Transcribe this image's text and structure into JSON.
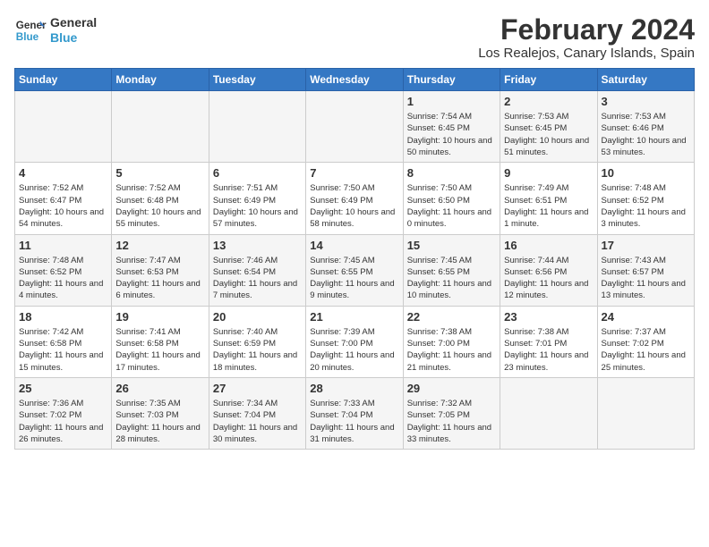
{
  "header": {
    "logo_general": "General",
    "logo_blue": "Blue",
    "month_year": "February 2024",
    "location": "Los Realejos, Canary Islands, Spain"
  },
  "days_of_week": [
    "Sunday",
    "Monday",
    "Tuesday",
    "Wednesday",
    "Thursday",
    "Friday",
    "Saturday"
  ],
  "weeks": [
    [
      {
        "day": "",
        "info": ""
      },
      {
        "day": "",
        "info": ""
      },
      {
        "day": "",
        "info": ""
      },
      {
        "day": "",
        "info": ""
      },
      {
        "day": "1",
        "info": "Sunrise: 7:54 AM\nSunset: 6:45 PM\nDaylight: 10 hours and 50 minutes."
      },
      {
        "day": "2",
        "info": "Sunrise: 7:53 AM\nSunset: 6:45 PM\nDaylight: 10 hours and 51 minutes."
      },
      {
        "day": "3",
        "info": "Sunrise: 7:53 AM\nSunset: 6:46 PM\nDaylight: 10 hours and 53 minutes."
      }
    ],
    [
      {
        "day": "4",
        "info": "Sunrise: 7:52 AM\nSunset: 6:47 PM\nDaylight: 10 hours and 54 minutes."
      },
      {
        "day": "5",
        "info": "Sunrise: 7:52 AM\nSunset: 6:48 PM\nDaylight: 10 hours and 55 minutes."
      },
      {
        "day": "6",
        "info": "Sunrise: 7:51 AM\nSunset: 6:49 PM\nDaylight: 10 hours and 57 minutes."
      },
      {
        "day": "7",
        "info": "Sunrise: 7:50 AM\nSunset: 6:49 PM\nDaylight: 10 hours and 58 minutes."
      },
      {
        "day": "8",
        "info": "Sunrise: 7:50 AM\nSunset: 6:50 PM\nDaylight: 11 hours and 0 minutes."
      },
      {
        "day": "9",
        "info": "Sunrise: 7:49 AM\nSunset: 6:51 PM\nDaylight: 11 hours and 1 minute."
      },
      {
        "day": "10",
        "info": "Sunrise: 7:48 AM\nSunset: 6:52 PM\nDaylight: 11 hours and 3 minutes."
      }
    ],
    [
      {
        "day": "11",
        "info": "Sunrise: 7:48 AM\nSunset: 6:52 PM\nDaylight: 11 hours and 4 minutes."
      },
      {
        "day": "12",
        "info": "Sunrise: 7:47 AM\nSunset: 6:53 PM\nDaylight: 11 hours and 6 minutes."
      },
      {
        "day": "13",
        "info": "Sunrise: 7:46 AM\nSunset: 6:54 PM\nDaylight: 11 hours and 7 minutes."
      },
      {
        "day": "14",
        "info": "Sunrise: 7:45 AM\nSunset: 6:55 PM\nDaylight: 11 hours and 9 minutes."
      },
      {
        "day": "15",
        "info": "Sunrise: 7:45 AM\nSunset: 6:55 PM\nDaylight: 11 hours and 10 minutes."
      },
      {
        "day": "16",
        "info": "Sunrise: 7:44 AM\nSunset: 6:56 PM\nDaylight: 11 hours and 12 minutes."
      },
      {
        "day": "17",
        "info": "Sunrise: 7:43 AM\nSunset: 6:57 PM\nDaylight: 11 hours and 13 minutes."
      }
    ],
    [
      {
        "day": "18",
        "info": "Sunrise: 7:42 AM\nSunset: 6:58 PM\nDaylight: 11 hours and 15 minutes."
      },
      {
        "day": "19",
        "info": "Sunrise: 7:41 AM\nSunset: 6:58 PM\nDaylight: 11 hours and 17 minutes."
      },
      {
        "day": "20",
        "info": "Sunrise: 7:40 AM\nSunset: 6:59 PM\nDaylight: 11 hours and 18 minutes."
      },
      {
        "day": "21",
        "info": "Sunrise: 7:39 AM\nSunset: 7:00 PM\nDaylight: 11 hours and 20 minutes."
      },
      {
        "day": "22",
        "info": "Sunrise: 7:38 AM\nSunset: 7:00 PM\nDaylight: 11 hours and 21 minutes."
      },
      {
        "day": "23",
        "info": "Sunrise: 7:38 AM\nSunset: 7:01 PM\nDaylight: 11 hours and 23 minutes."
      },
      {
        "day": "24",
        "info": "Sunrise: 7:37 AM\nSunset: 7:02 PM\nDaylight: 11 hours and 25 minutes."
      }
    ],
    [
      {
        "day": "25",
        "info": "Sunrise: 7:36 AM\nSunset: 7:02 PM\nDaylight: 11 hours and 26 minutes."
      },
      {
        "day": "26",
        "info": "Sunrise: 7:35 AM\nSunset: 7:03 PM\nDaylight: 11 hours and 28 minutes."
      },
      {
        "day": "27",
        "info": "Sunrise: 7:34 AM\nSunset: 7:04 PM\nDaylight: 11 hours and 30 minutes."
      },
      {
        "day": "28",
        "info": "Sunrise: 7:33 AM\nSunset: 7:04 PM\nDaylight: 11 hours and 31 minutes."
      },
      {
        "day": "29",
        "info": "Sunrise: 7:32 AM\nSunset: 7:05 PM\nDaylight: 11 hours and 33 minutes."
      },
      {
        "day": "",
        "info": ""
      },
      {
        "day": "",
        "info": ""
      }
    ]
  ]
}
